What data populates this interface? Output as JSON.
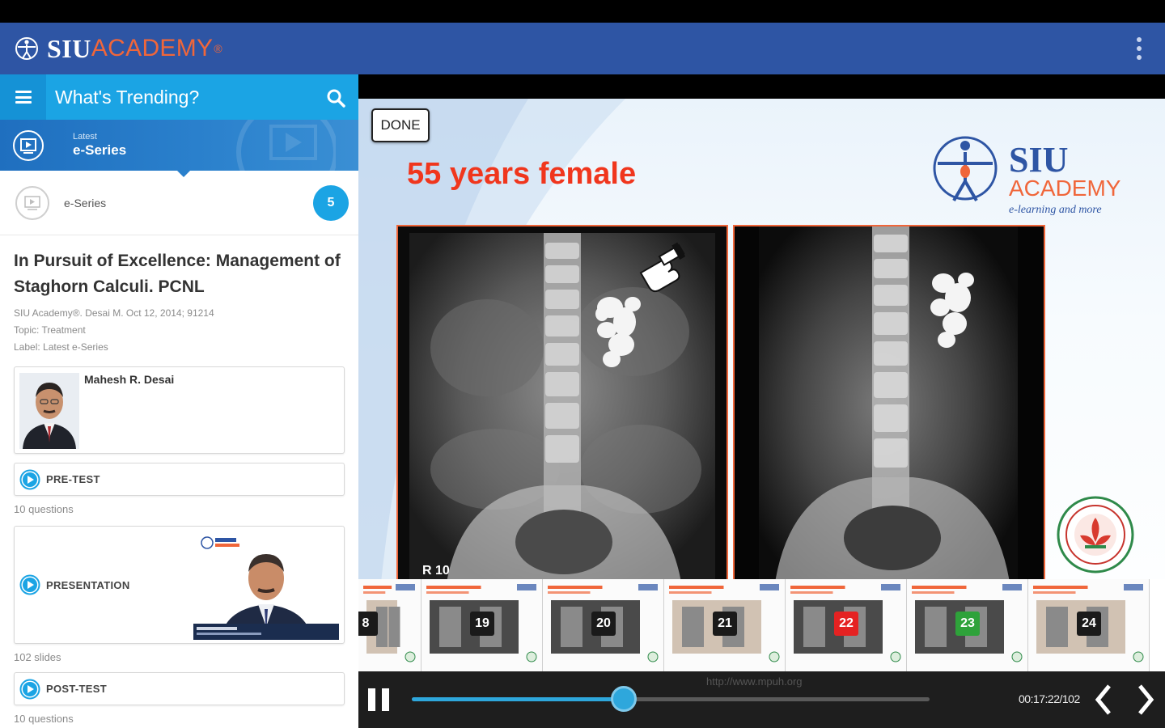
{
  "app": {
    "brand_siu": "SIU",
    "brand_academy": "ACADEMY",
    "brand_dot": "®"
  },
  "sidebar": {
    "title": "What's Trending?",
    "banner_sub": "Latest",
    "banner_main": "e-Series",
    "row_label": "e-Series",
    "row_count": "5"
  },
  "course": {
    "title": "In Pursuit of Excellence: Management of Staghorn Calculi. PCNL",
    "byline": "SIU Academy®. Desai M. Oct 12, 2014; 91214",
    "topic": "Topic: Treatment",
    "label": "Label: Latest e-Series",
    "author": "Mahesh R. Desai",
    "pretest_label": "PRE-TEST",
    "pretest_note": "10 questions",
    "presentation_label": "PRESENTATION",
    "presentation_note": "102 slides",
    "posttest_label": "POST-TEST",
    "posttest_note": "10 questions"
  },
  "viewer": {
    "done_label": "DONE",
    "slide_title": "55 years female",
    "logo_siu": "SIU",
    "logo_academy": "ACADEMY",
    "logo_tagline": "e-learning and more",
    "xray_marker": "R 10",
    "thumbnails": [
      {
        "num": "8",
        "style": "dark"
      },
      {
        "num": "19",
        "style": "dark"
      },
      {
        "num": "20",
        "style": "dark"
      },
      {
        "num": "21",
        "style": "dark"
      },
      {
        "num": "22",
        "style": "red"
      },
      {
        "num": "23",
        "style": "green"
      },
      {
        "num": "24",
        "style": "dark"
      }
    ],
    "url_text": "http://www.mpuh.org",
    "time": "00:17:22/102",
    "progress": 0.41
  },
  "colors": {
    "app_bar": "#2e55a4",
    "accent": "#1ba4e4",
    "brand_orange": "#f0663a",
    "slide_title_red": "#f0361d"
  },
  "icons": {
    "menu": "menu-icon",
    "search": "search-icon",
    "overflow": "overflow-menu-icon",
    "series": "presentation-icon",
    "play": "play-circle-icon",
    "pause": "pause-icon",
    "prev": "chevron-left-icon",
    "next": "chevron-right-icon"
  }
}
